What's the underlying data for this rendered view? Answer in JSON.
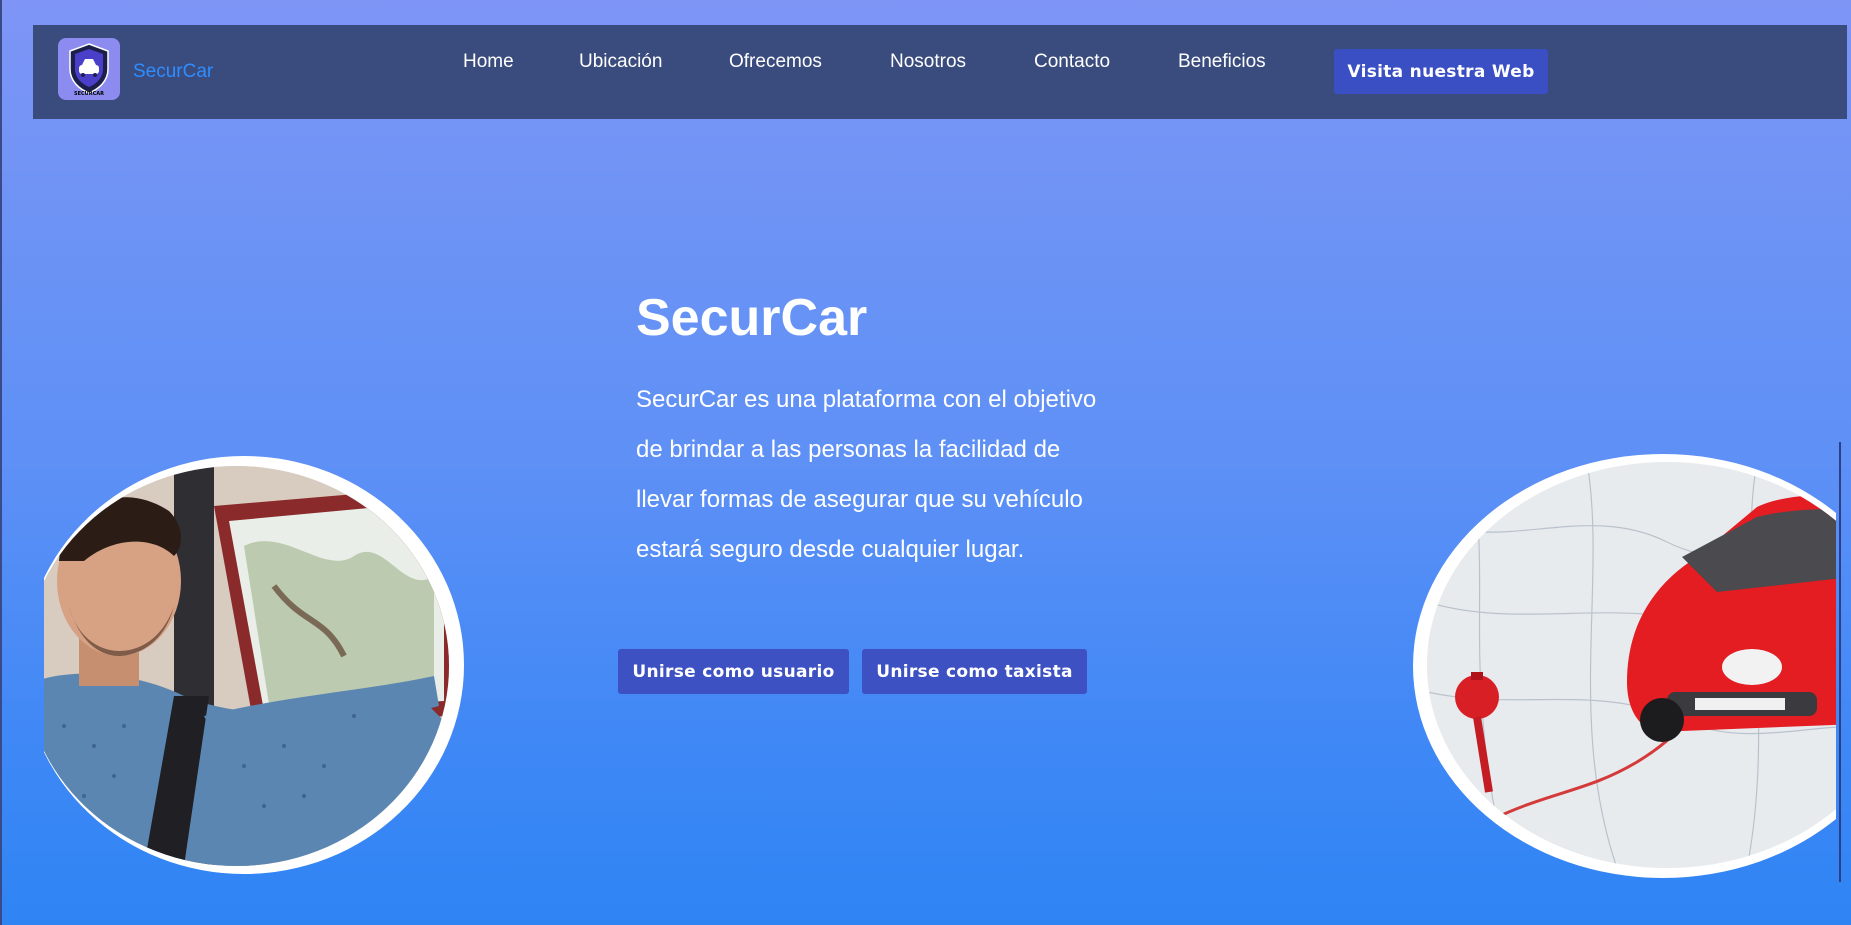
{
  "brand": {
    "name": "SecurCar",
    "logo_caption": "SECURCAR",
    "logo_icon": "shield-car-icon"
  },
  "nav": {
    "items": [
      {
        "label": "Home"
      },
      {
        "label": "Ubicación"
      },
      {
        "label": "Ofrecemos"
      },
      {
        "label": "Nosotros"
      },
      {
        "label": "Contacto"
      },
      {
        "label": "Beneficios"
      }
    ],
    "cta_label": "Visita nuestra Web"
  },
  "hero": {
    "title": "SecurCar",
    "description_lines": [
      "SecurCar es una plataforma con el objetivo",
      "de brindar a las personas la facilidad de",
      "llevar formas de asegurar que su vehículo",
      "estará seguro desde cualquier lugar."
    ],
    "buttons": {
      "user_label": "Unirse como usuario",
      "taxi_label": "Unirse como taxista"
    }
  },
  "images": {
    "left": "man-driving-photo",
    "right": "red-car-on-map-photo"
  },
  "colors": {
    "navbar_bg": "#3a4b7e",
    "button_bg": "#3e51c2",
    "brand_text": "#2e8dff",
    "background_top": "#7e95f6",
    "background_bottom": "#2f84f4"
  }
}
